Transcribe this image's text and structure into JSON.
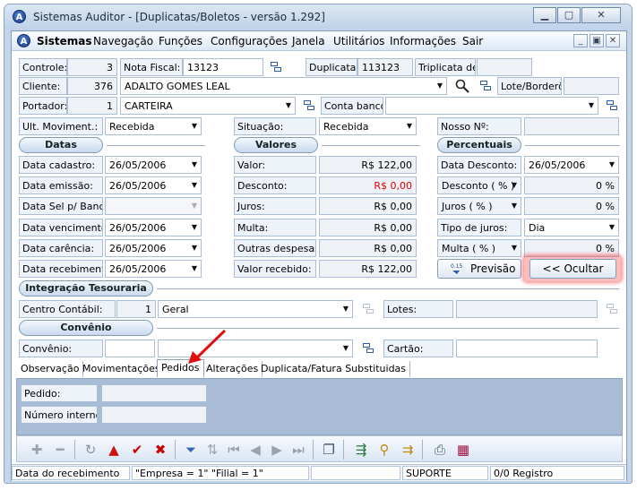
{
  "window": {
    "title": "Sistemas Auditor - [Duplicatas/Boletos - versão 1.292]"
  },
  "menu": {
    "app_name": "Sistemas",
    "items": [
      "Navegação",
      "Funções",
      "Configurações",
      "Janela",
      "Utilitários",
      "Informações",
      "Sair"
    ]
  },
  "header": {
    "controle_label": "Controle:",
    "controle_value": "3",
    "nota_fiscal_label": "Nota Fiscal:",
    "nota_fiscal_value": "13123",
    "duplicata_label": "Duplicata:",
    "duplicata_value": "113123",
    "triplicata_label": "Triplicata de:",
    "triplicata_value": "",
    "cliente_label": "Cliente:",
    "cliente_code": "376",
    "cliente_name": "ADALTO GOMES LEAL",
    "lote_label": "Lote/Borderô:",
    "lote_value": "",
    "portador_label": "Portador:",
    "portador_code": "1",
    "portador_name": "CARTEIRA",
    "conta_banco_label": "Conta banco:",
    "conta_banco_value": "",
    "ult_mov_label": "Ult. Moviment.:",
    "ult_mov_value": "Recebida",
    "situacao_label": "Situação:",
    "situacao_value": "Recebida",
    "nosso_label": "Nosso Nº:",
    "nosso_value": ""
  },
  "datas": {
    "section_title": "Datas",
    "rows": [
      {
        "label": "Data cadastro:",
        "value": "26/05/2006"
      },
      {
        "label": "Data emissão:",
        "value": "26/05/2006"
      },
      {
        "label": "Data Sel p/ Banco:",
        "value": ""
      },
      {
        "label": "Data vencimento:",
        "value": "26/05/2006"
      },
      {
        "label": "Data carência:",
        "value": "26/05/2006"
      },
      {
        "label": "Data recebimento:",
        "value": "26/05/2006"
      }
    ]
  },
  "valores": {
    "section_title": "Valores",
    "rows": [
      {
        "label": "Valor:",
        "value": "R$ 122,00"
      },
      {
        "label": "Desconto:",
        "value": "R$ 0,00"
      },
      {
        "label": "Juros:",
        "value": "R$ 0,00"
      },
      {
        "label": "Multa:",
        "value": "R$ 0,00"
      },
      {
        "label": "Outras despesas:",
        "value": "R$ 0,00"
      },
      {
        "label": "Valor recebido:",
        "value": "R$ 122,00"
      }
    ],
    "desconto_color": "#e00000"
  },
  "percentuais": {
    "section_title": "Percentuais",
    "data_desconto_label": "Data Desconto:",
    "data_desconto_value": "26/05/2006",
    "desconto_pct_label": "Desconto ( % )",
    "desconto_pct_value": "0 %",
    "juros_pct_label": "Juros ( % )",
    "juros_pct_value": "0 %",
    "tipo_juros_label": "Tipo de juros:",
    "tipo_juros_value": "Dia",
    "multa_pct_label": "Multa ( % )",
    "multa_pct_value": "0 %",
    "previsao_button": "Previsão",
    "ocultar_button": "<< Ocultar",
    "ocultar_highlight": "#f04040"
  },
  "integracao": {
    "section_title": "Integração Tesouraria",
    "centro_label": "Centro Contábil:",
    "centro_code": "1",
    "centro_name": "Geral",
    "lotes_label": "Lotes:",
    "lotes_value": ""
  },
  "convenio": {
    "section_title": "Convênio",
    "convenio_label": "Convênio:",
    "convenio_code": "",
    "convenio_name": "",
    "cartao_label": "Cartão:",
    "cartao_value": ""
  },
  "tabs": [
    {
      "label": "Observação"
    },
    {
      "label": "Movimentações"
    },
    {
      "label": "Pedidos"
    },
    {
      "label": "Alterações"
    },
    {
      "label": "Duplicata/Fatura Substituidas"
    }
  ],
  "active_tab": "Pedidos",
  "pedidos": {
    "pedido_label": "Pedido:",
    "pedido_value": "",
    "numero_interno_label": "Número interno:",
    "numero_interno_value": ""
  },
  "annotation": {
    "arrow_color": "#e01010"
  },
  "statusbar": {
    "field": "Data do recebimento",
    "empresa": "\"Empresa = 1\"   \"Filial = 1\"",
    "blank": "",
    "user": "SUPORTE",
    "registro": "0/0 Registro"
  }
}
